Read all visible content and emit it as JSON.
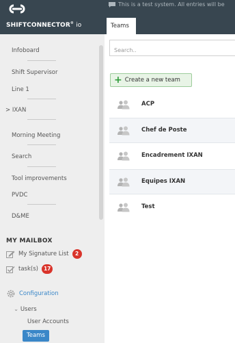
{
  "app": {
    "brand_name": "SHIFTCONNECTOR",
    "brand_suffix": "io",
    "system_notice": "This is a test system. All entries will be"
  },
  "sidebar": {
    "nav_items": [
      {
        "label": "Infoboard"
      },
      {
        "label": "Shift Supervisor"
      },
      {
        "label": "Line 1"
      },
      {
        "label": "> IXAN"
      },
      {
        "label": "Morning Meeting"
      },
      {
        "label": "Search"
      },
      {
        "label": "Tool improvements"
      },
      {
        "label": "PVDC"
      },
      {
        "label": "D&ME"
      }
    ],
    "mailbox": {
      "title": "MY MAILBOX",
      "signature_list": {
        "label": "My Signature List",
        "count": "2"
      },
      "tasks": {
        "label": "task(s)",
        "count": "17"
      }
    },
    "configuration": {
      "label": "Configuration",
      "users": "Users",
      "user_accounts": "User Accounts",
      "teams": "Teams"
    }
  },
  "main": {
    "tab": "Teams",
    "search_placeholder": "Search..",
    "create_button": "Create a new team",
    "teams": [
      {
        "name": "ACP"
      },
      {
        "name": "Chef de Poste"
      },
      {
        "name": "Encadrement IXAN"
      },
      {
        "name": "Equipes IXAN"
      },
      {
        "name": "Test"
      }
    ]
  },
  "colors": {
    "header_bg": "#384650",
    "accent": "#3a87c8",
    "badge": "#d9342b",
    "create_btn_bg": "#e8f4e6"
  }
}
